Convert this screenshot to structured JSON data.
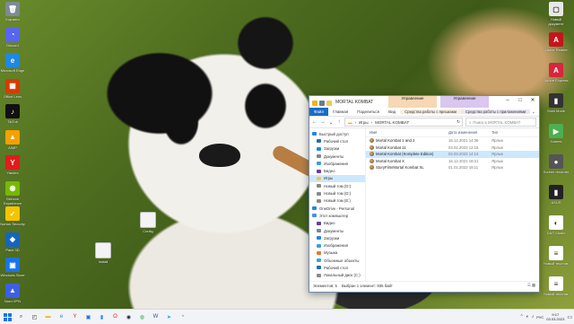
{
  "desktop": {
    "icons_left": [
      {
        "label": "Корзина",
        "color": "#7d8a96",
        "glyph": "🗑"
      },
      {
        "label": "Discord",
        "color": "#5865f2",
        "glyph": "◔"
      },
      {
        "label": "Microsoft Edge",
        "color": "#1e88e5",
        "glyph": "e"
      },
      {
        "label": "Office Lens",
        "color": "#d83b01",
        "glyph": "▦"
      },
      {
        "label": "TikTok",
        "color": "#111111",
        "glyph": "♪"
      },
      {
        "label": "AIMP",
        "color": "#f5a000",
        "glyph": "▲"
      },
      {
        "label": "Yandex",
        "color": "#e21b1b",
        "glyph": "Y"
      },
      {
        "label": "Geforce Experience",
        "color": "#76b900",
        "glyph": "◉"
      },
      {
        "label": "Norton Security",
        "color": "#f5c400",
        "glyph": "✓"
      },
      {
        "label": "Paint 3D",
        "color": "#1565c0",
        "glyph": "◆"
      },
      {
        "label": "Windows Store",
        "color": "#1a73e8",
        "glyph": "▣"
      },
      {
        "label": "Nord VPN",
        "color": "#3e5fe5",
        "glyph": "▲"
      }
    ],
    "icons_right": [
      {
        "label": "Новый документ",
        "color": "#e8e8e8",
        "glyph": "▢"
      },
      {
        "label": "Adobe Reader",
        "color": "#c4161c",
        "glyph": "A"
      },
      {
        "label": "Adobe Express",
        "color": "#d7263d",
        "glyph": "A"
      },
      {
        "label": "Shell Mode",
        "color": "#333333",
        "glyph": "▮"
      },
      {
        "label": "Games",
        "color": "#4caf50",
        "glyph": "▶"
      },
      {
        "label": "Screen recorder",
        "color": "#555555",
        "glyph": "●"
      },
      {
        "label": "ASUS",
        "color": "#222222",
        "glyph": "▮"
      },
      {
        "label": "DAS Studio",
        "color": "#ffffff",
        "glyph": "◐"
      },
      {
        "label": "Новый текстов.",
        "color": "#ffffff",
        "glyph": "≡"
      },
      {
        "label": "Новый текстов.",
        "color": "#ffffff",
        "glyph": "≡"
      }
    ],
    "file_icons": [
      {
        "label": "Config",
        "color": "#f3f3f3"
      },
      {
        "label": "Install",
        "color": "#f3f3f3"
      }
    ]
  },
  "explorer": {
    "title": "MORTAL KOMBAT",
    "context_tabs": [
      {
        "head": "Управление",
        "label": "Средства работы с ярлыками",
        "color": "#f6d8b4",
        "label_bg": "#fbeee0"
      },
      {
        "head": "Управление",
        "label": "Средства работы с приложениями",
        "color": "#d9c7ee",
        "label_bg": "#eee4f8"
      }
    ],
    "ribbon_tabs": [
      "Файл",
      "Главная",
      "Поделиться",
      "Вид"
    ],
    "address": [
      "Игры",
      "MORTAL KOMBAT"
    ],
    "search_placeholder": "Поиск в MORTAL KOMBAT",
    "nav": [
      {
        "label": "Быстрый доступ",
        "color": "#1e88e5",
        "indent": false
      },
      {
        "label": "Рабочий стол",
        "color": "#2b6cb0",
        "indent": true
      },
      {
        "label": "Загрузки",
        "color": "#1e88e5",
        "indent": true
      },
      {
        "label": "Документы",
        "color": "#7a8796",
        "indent": true
      },
      {
        "label": "Изображения",
        "color": "#3f9fd8",
        "indent": true
      },
      {
        "label": "Видео",
        "color": "#6b3fa0",
        "indent": true
      },
      {
        "label": "Игры",
        "color": "#f2c94c",
        "indent": true
      },
      {
        "label": "Новый том (D:)",
        "color": "#8a8a8a",
        "indent": true
      },
      {
        "label": "Новый том (D:)",
        "color": "#8a8a8a",
        "indent": true
      },
      {
        "label": "Новый том (E:)",
        "color": "#8a8a8a",
        "indent": true
      },
      {
        "label": "OneDrive - Personal",
        "color": "#1e88e5",
        "indent": false
      },
      {
        "label": "Этот компьютер",
        "color": "#4a90d9",
        "indent": false
      },
      {
        "label": "Видео",
        "color": "#6b3fa0",
        "indent": true
      },
      {
        "label": "Документы",
        "color": "#7a8796",
        "indent": true
      },
      {
        "label": "Загрузки",
        "color": "#1e88e5",
        "indent": true
      },
      {
        "label": "Изображения",
        "color": "#3f9fd8",
        "indent": true
      },
      {
        "label": "Музыка",
        "color": "#e37a2e",
        "indent": true
      },
      {
        "label": "Объемные объекты",
        "color": "#3aa6c9",
        "indent": true
      },
      {
        "label": "Рабочий стол",
        "color": "#2b6cb0",
        "indent": true
      },
      {
        "label": "Локальный диск (C:)",
        "color": "#8a8a8a",
        "indent": true
      },
      {
        "label": "Новый том (D:)",
        "color": "#8a8a8a",
        "indent": true
      }
    ],
    "columns": [
      "Имя",
      "Дата изменения",
      "Тип"
    ],
    "rows": [
      {
        "name": "Mortal Kombat 1 and 2",
        "date": "15.12.2021 14:36",
        "type": "Ярлык",
        "selected": false
      },
      {
        "name": "Mortal Kombat 11",
        "date": "03.02.2023 12:15",
        "type": "Ярлык",
        "selected": false
      },
      {
        "name": "Mortal Kombat (Komplete Edition)",
        "date": "02.03.2023 14:14",
        "type": "Ярлык",
        "selected": true
      },
      {
        "name": "Mortal Kombat X",
        "date": "15.12.2021 18:21",
        "type": "Ярлык",
        "selected": false
      },
      {
        "name": "StoryFilm/Mortal Kombat XL",
        "date": "01.01.2022 19:11",
        "type": "Ярлык",
        "selected": false
      }
    ],
    "status": {
      "count": "Элементов: 5",
      "selection": "Выбран 1 элемент: 935 байт"
    }
  },
  "taskbar": {
    "apps": [
      {
        "name": "search",
        "glyph": "⌕",
        "color": "#333333"
      },
      {
        "name": "task-view",
        "glyph": "◰",
        "color": "#333333"
      },
      {
        "name": "file-explorer",
        "glyph": "▬",
        "color": "#f2b31b"
      },
      {
        "name": "edge",
        "glyph": "e",
        "color": "#1e88e5"
      },
      {
        "name": "yandex",
        "glyph": "Y",
        "color": "#e21b1b"
      },
      {
        "name": "store",
        "glyph": "▣",
        "color": "#1a73e8"
      },
      {
        "name": "vk",
        "glyph": "▮",
        "color": "#2787f5"
      },
      {
        "name": "opera",
        "glyph": "O",
        "color": "#e0202c"
      },
      {
        "name": "steam",
        "glyph": "◉",
        "color": "#1b2838"
      },
      {
        "name": "chrome",
        "glyph": "◍",
        "color": "#34a853"
      },
      {
        "name": "word",
        "glyph": "W",
        "color": "#2b579a"
      },
      {
        "name": "telegram",
        "glyph": "➤",
        "color": "#2aa3df"
      },
      {
        "name": "discord",
        "glyph": "◔",
        "color": "#5865f2"
      }
    ],
    "tray_lang": "РУС",
    "time": "9:17",
    "date": "03.03.2023"
  }
}
